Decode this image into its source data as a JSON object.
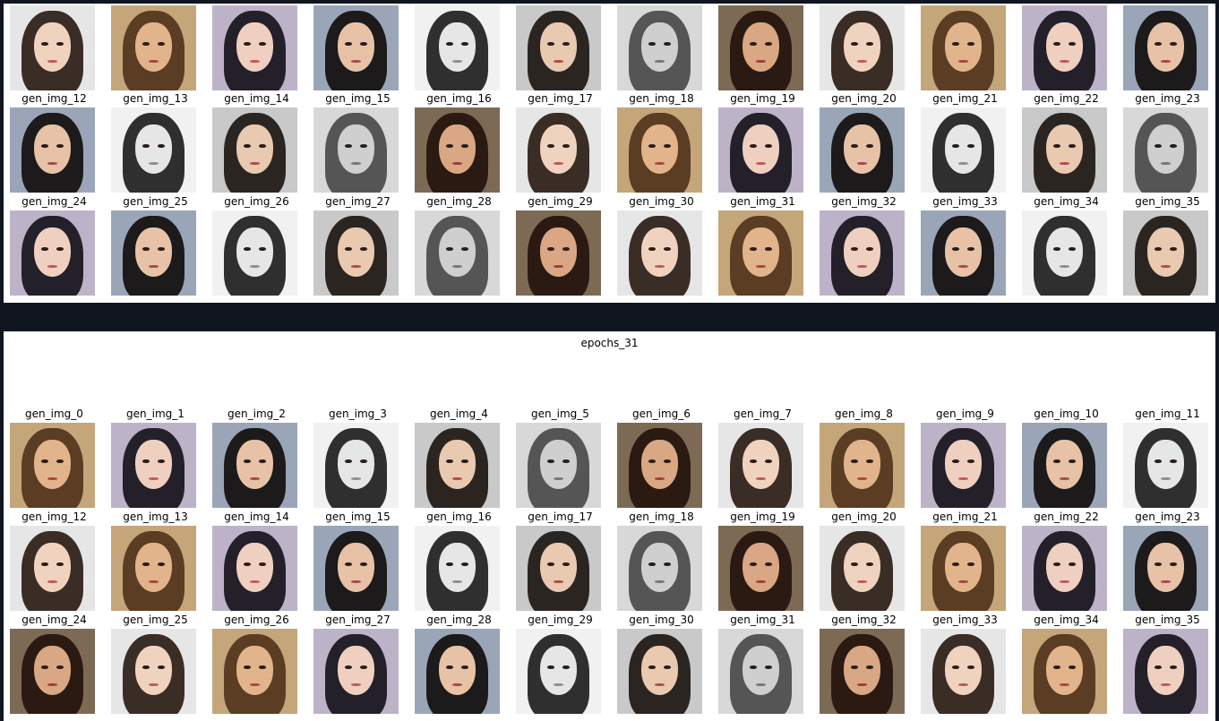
{
  "top_panel": {
    "rows": [
      [
        "gen_img_12",
        "gen_img_13",
        "gen_img_14",
        "gen_img_15",
        "gen_img_16",
        "gen_img_17",
        "gen_img_18",
        "gen_img_19",
        "gen_img_20",
        "gen_img_21",
        "gen_img_22",
        "gen_img_23"
      ],
      [
        "gen_img_24",
        "gen_img_25",
        "gen_img_26",
        "gen_img_27",
        "gen_img_28",
        "gen_img_29",
        "gen_img_30",
        "gen_img_31",
        "gen_img_32",
        "gen_img_33",
        "gen_img_34",
        "gen_img_35"
      ]
    ]
  },
  "bottom_panel": {
    "title": "epochs_31",
    "rows": [
      [
        "gen_img_0",
        "gen_img_1",
        "gen_img_2",
        "gen_img_3",
        "gen_img_4",
        "gen_img_5",
        "gen_img_6",
        "gen_img_7",
        "gen_img_8",
        "gen_img_9",
        "gen_img_10",
        "gen_img_11"
      ],
      [
        "gen_img_12",
        "gen_img_13",
        "gen_img_14",
        "gen_img_15",
        "gen_img_16",
        "gen_img_17",
        "gen_img_18",
        "gen_img_19",
        "gen_img_20",
        "gen_img_21",
        "gen_img_22",
        "gen_img_23"
      ],
      [
        "gen_img_24",
        "gen_img_25",
        "gen_img_26",
        "gen_img_27",
        "gen_img_28",
        "gen_img_29",
        "gen_img_30",
        "gen_img_31",
        "gen_img_32",
        "gen_img_33",
        "gen_img_34",
        "gen_img_35"
      ]
    ]
  },
  "colors": {
    "page_background": "#111520",
    "panel_background": "#ffffff",
    "label_text": "#000000"
  }
}
